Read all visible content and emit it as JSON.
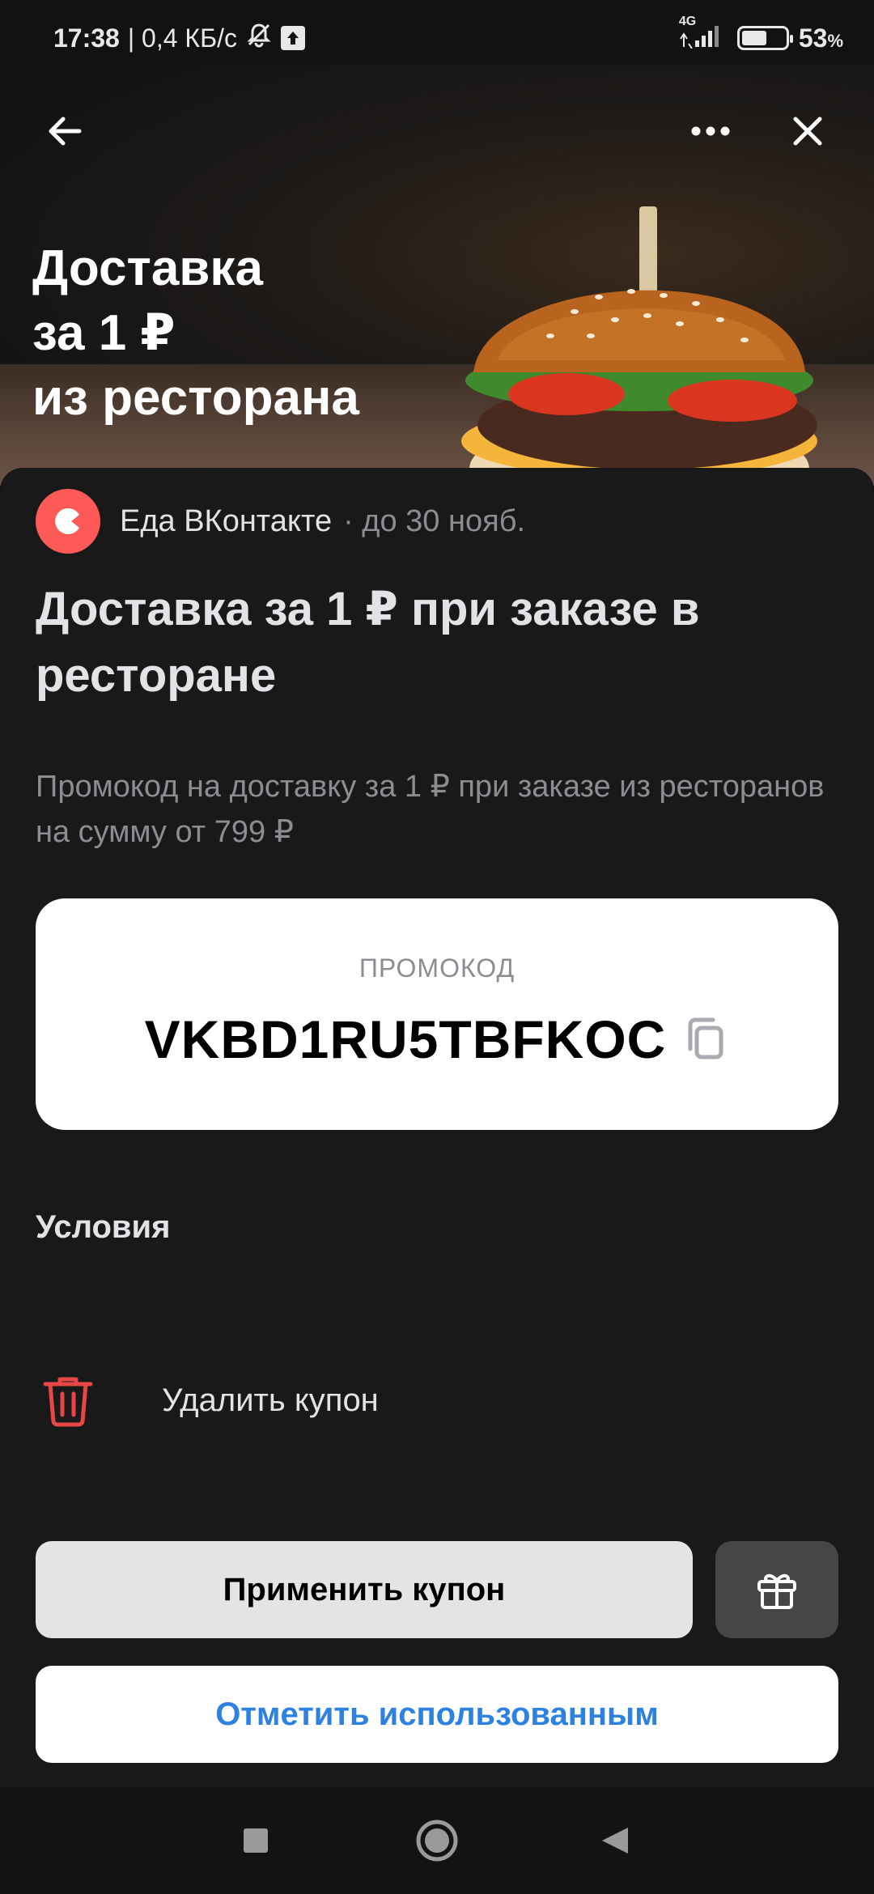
{
  "status_bar": {
    "time": "17:38",
    "network_speed": "| 0,4 КБ/с",
    "network_type": "4G",
    "battery": "53",
    "battery_unit": "%"
  },
  "hero": {
    "title_line1": "Доставка",
    "title_line2": "за 1 ₽",
    "title_line3": "из ресторана",
    "back_icon": "arrow-left-icon",
    "more_icon": "more-horizontal-icon",
    "close_icon": "close-icon"
  },
  "coupon": {
    "source_name": "Еда ВКонтакте",
    "date": "· до 30 нояб.",
    "title": "Доставка за 1 ₽ при заказе в ресторане",
    "description": "Промокод на доставку за 1 ₽ при заказе из ресторанов на сумму от 799 ₽",
    "promo_label": "ПРОМОКОД",
    "promo_code": "VKBD1RU5TBFKOC",
    "conditions_label": "Условия",
    "delete_label": "Удалить купон"
  },
  "actions": {
    "apply_label": "Применить купон",
    "mark_used_label": "Отметить использованным"
  },
  "colors": {
    "accent_blue": "#2d81e0",
    "brand_red": "#ff5a57",
    "sheet_bg": "#19191a"
  }
}
